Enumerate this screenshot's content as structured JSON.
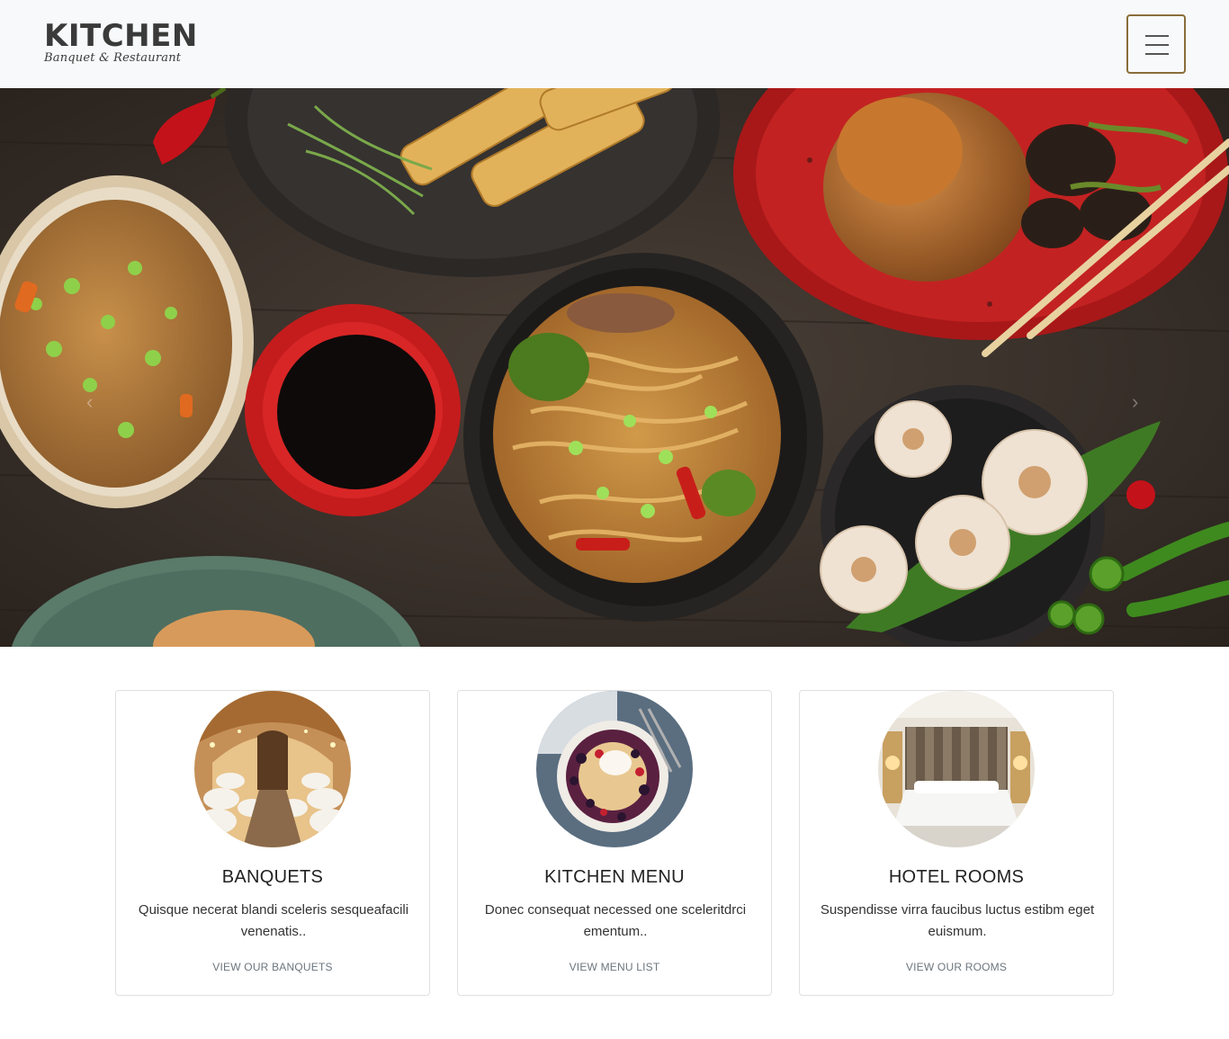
{
  "brand": {
    "title": "KITCHEN",
    "subtitle": "Banquet & Restaurant"
  },
  "nav": {
    "toggler_icon": "hamburger-icon",
    "accent": "#8a6d3b"
  },
  "hero": {
    "prev_icon": "chevron-left-icon",
    "next_icon": "chevron-right-icon",
    "prev_glyph": "‹",
    "next_glyph": "›"
  },
  "cards": [
    {
      "title": "BANQUETS",
      "text": "Quisque necerat blandi sceleris sesqueafacili venenatis..",
      "link": "VIEW OUR BANQUETS"
    },
    {
      "title": "KITCHEN MENU",
      "text": "Donec consequat necessed one sceleritdrci ementum..",
      "link": "VIEW MENU LIST"
    },
    {
      "title": "HOTEL ROOMS",
      "text": "Suspendisse virra faucibus luctus estibm eget euismum.",
      "link": "VIEW OUR ROOMS"
    }
  ]
}
